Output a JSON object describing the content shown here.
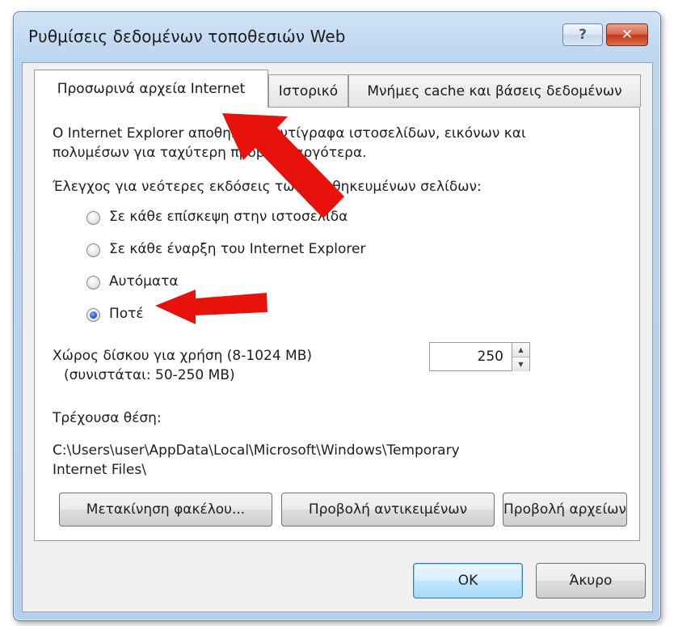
{
  "window": {
    "title": "Ρυθμίσεις δεδομένων τοποθεσιών Web",
    "help_label": "?",
    "close_label": "✕"
  },
  "tabs": [
    {
      "label": "Προσωρινά αρχεία Internet",
      "active": true
    },
    {
      "label": "Ιστορικό",
      "active": false
    },
    {
      "label": "Μνήμες cache και βάσεις δεδομένων",
      "active": false
    }
  ],
  "panel": {
    "description_line1": "O Internet Explorer αποθηκεύει αντίγραφα ιστοσελίδων, εικόνων και",
    "description_line2": "πολυμέσων για ταχύτερη προβολή αργότερα.",
    "check_label": "Έλεγχος για νεότερες εκδόσεις των αποθηκευμένων σελίδων:",
    "options": [
      {
        "label": "Σε κάθε επίσκεψη στην ιστοσελίδα",
        "checked": false
      },
      {
        "label": "Σε κάθε έναρξη του Internet Explorer",
        "checked": false
      },
      {
        "label": "Αυτόματα",
        "checked": false
      },
      {
        "label": "Ποτέ",
        "checked": true
      }
    ],
    "disk_label_line1": "Χώρος δίσκου για χρήση (8-1024 MB)",
    "disk_label_line2": "(συνιστάται: 50-250 MB)",
    "disk_value": "250",
    "location_label": "Τρέχουσα θέση:",
    "location_line1": "C:\\Users\\user\\AppData\\Local\\Microsoft\\Windows\\Temporary",
    "location_line2": "Internet Files\\",
    "move_folder_label": "Μετακίνηση φακέλου...",
    "view_objects_label": "Προβολή αντικειμένων",
    "view_files_label": "Προβολή αρχείων"
  },
  "footer": {
    "ok_label": "OK",
    "cancel_label": "Άκυρο"
  },
  "colors": {
    "arrow": "#e8120c",
    "title_bar": "#bcd5ef",
    "close_button": "#c3371b"
  }
}
